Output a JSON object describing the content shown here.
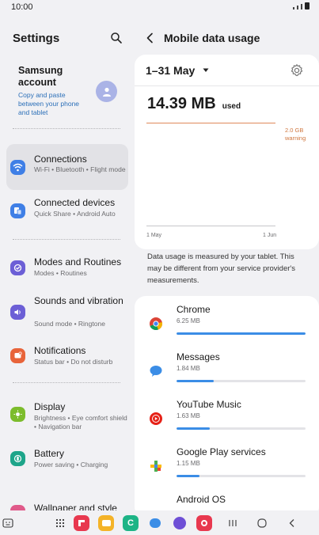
{
  "status_bar": {
    "time": "10:00"
  },
  "left": {
    "title": "Settings",
    "account": {
      "name": "Samsung account",
      "subtitle": "Copy and paste between your phone and tablet"
    },
    "items": [
      {
        "label": "Connections",
        "sub": "Wi-Fi • Bluetooth • Flight mode",
        "icon": "wifi-icon",
        "color": "#3f7fe6"
      },
      {
        "label": "Connected devices",
        "sub": "Quick Share • Android Auto",
        "icon": "devices-icon",
        "color": "#3f7fe6"
      },
      {
        "label": "Modes and Routines",
        "sub": "Modes • Routines",
        "icon": "routines-icon",
        "color": "#6c5fd6"
      },
      {
        "label": "Sounds and vibration",
        "sub": "Sound mode • Ringtone",
        "icon": "sound-icon",
        "color": "#6c5fd6"
      },
      {
        "label": "Notifications",
        "sub": "Status bar • Do not disturb",
        "icon": "notification-icon",
        "color": "#e8643a"
      },
      {
        "label": "Display",
        "sub": "Brightness • Eye comfort shield • Navigation bar",
        "icon": "display-icon",
        "color": "#7cbc2c"
      },
      {
        "label": "Battery",
        "sub": "Power saving • Charging",
        "icon": "battery-icon",
        "color": "#1ea58a"
      },
      {
        "label": "Wallpaper and style",
        "sub": "",
        "icon": "wallpaper-icon",
        "color": "#e05a8a"
      }
    ]
  },
  "right": {
    "title": "Mobile data usage",
    "period": "1–31 May",
    "usage": {
      "amount": "14.39 MB",
      "label": "used"
    },
    "warning": {
      "line1": "2.0 GB",
      "line2": "warning"
    },
    "axis": {
      "start": "1 May",
      "end": "1 Jun"
    },
    "note": "Data usage is measured by your tablet. This may be different from your service provider's measurements.",
    "apps": [
      {
        "name": "Chrome",
        "size": "6.25 MB",
        "icon": "chrome-icon",
        "fraction": 1.0
      },
      {
        "name": "Messages",
        "size": "1.84 MB",
        "icon": "messages-icon",
        "fraction": 0.29
      },
      {
        "name": "YouTube Music",
        "size": "1.63 MB",
        "icon": "youtube-music-icon",
        "fraction": 0.26
      },
      {
        "name": "Google Play services",
        "size": "1.15 MB",
        "icon": "play-services-icon",
        "fraction": 0.18
      },
      {
        "name": "Android OS",
        "size": "",
        "icon": "android-os-icon",
        "fraction": 0.0
      }
    ]
  },
  "colors": {
    "accent": "#3b8de6",
    "warning": "#d0773f"
  }
}
